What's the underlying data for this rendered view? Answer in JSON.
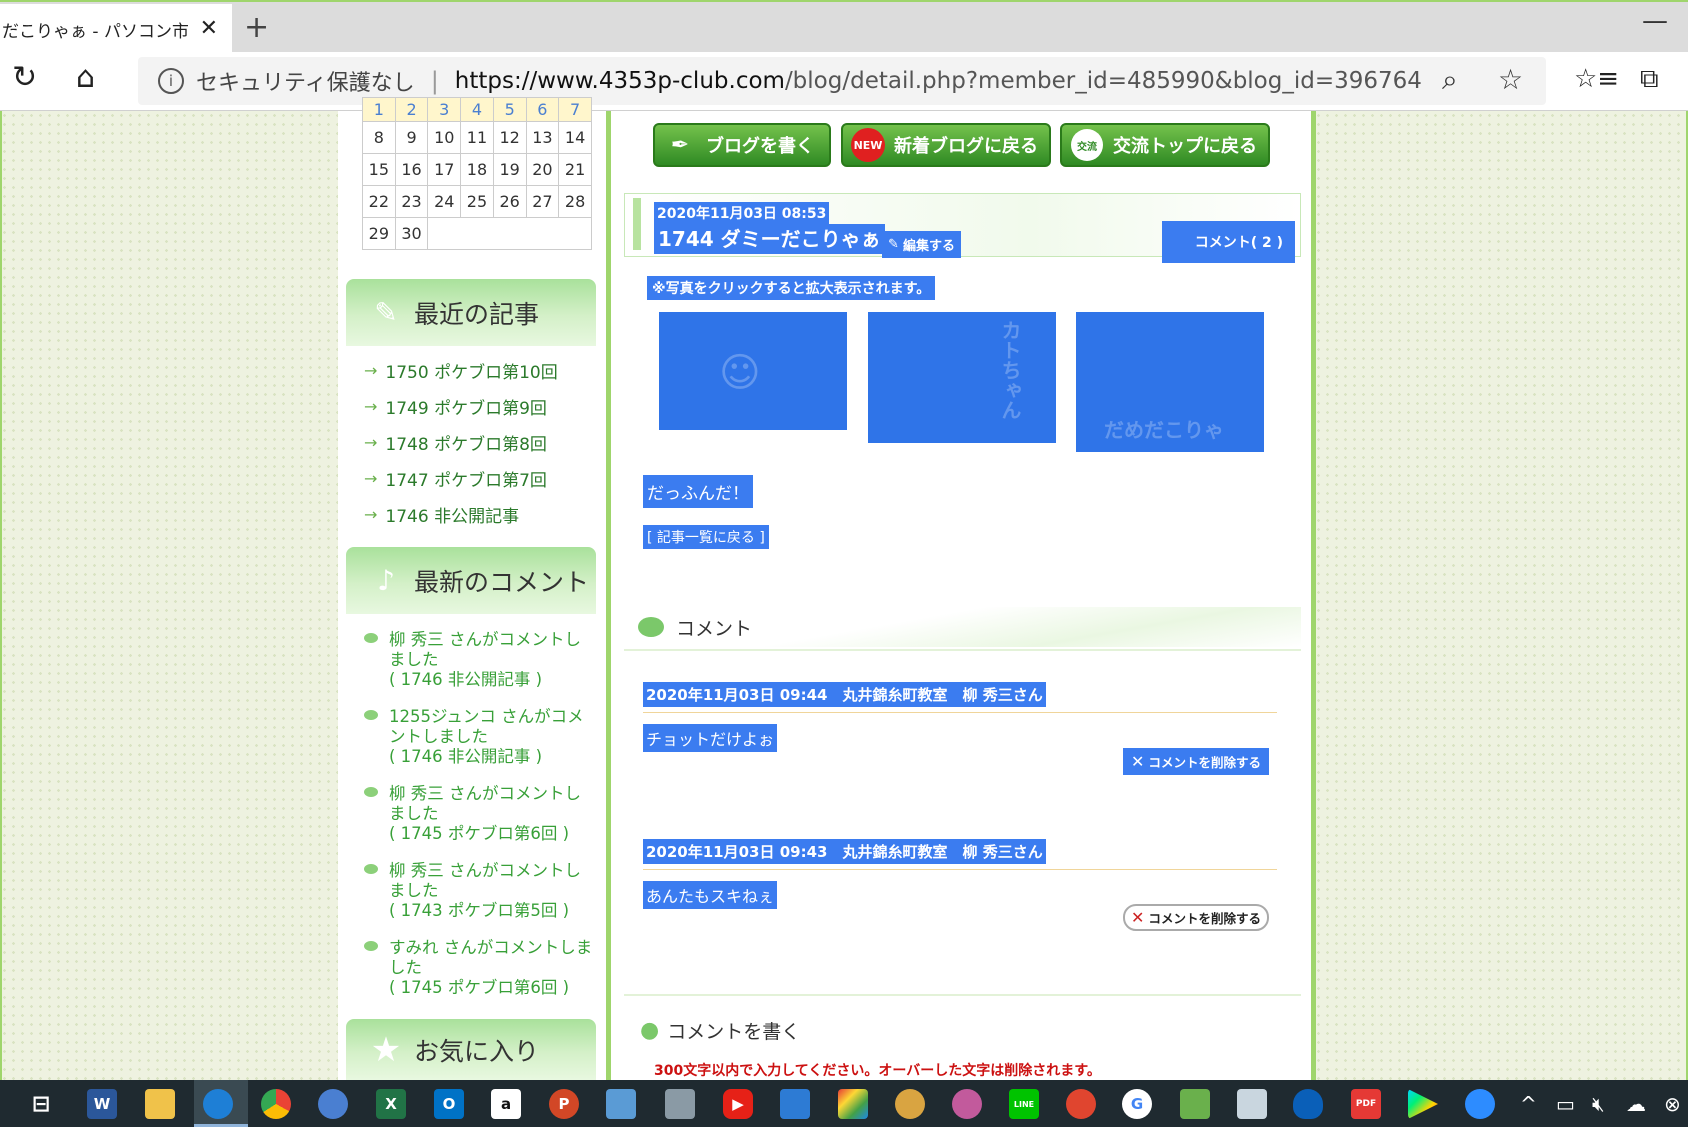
{
  "browser": {
    "tab_title": "だこりゃぁ - パソコン市民講",
    "tab_close": "✕",
    "new_tab": "+",
    "minimize": "—",
    "security_label": "セキュリティ保護なし",
    "url_host": "https://www.4353p-club.com",
    "url_path": "/blog/detail.php?member_id=485990&blog_id=396764"
  },
  "calendar": {
    "rows": [
      [
        "1",
        "2",
        "3",
        "4",
        "5",
        "6",
        "7"
      ],
      [
        "8",
        "9",
        "10",
        "11",
        "12",
        "13",
        "14"
      ],
      [
        "15",
        "16",
        "17",
        "18",
        "19",
        "20",
        "21"
      ],
      [
        "22",
        "23",
        "24",
        "25",
        "26",
        "27",
        "28"
      ],
      [
        "29",
        "30",
        "",
        "",
        "",
        "",
        ""
      ]
    ]
  },
  "sidebar": {
    "recent_title": "最近の記事",
    "recent": [
      "1750 ポケブロ第10回",
      "1749 ポケブロ第9回",
      "1748 ポケブロ第8回",
      "1747 ポケブロ第7回",
      "1746 非公開記事"
    ],
    "comments_title": "最新のコメント",
    "comments": [
      {
        "text": "柳 秀三 さんがコメントしました",
        "ref": "( 1746 非公開記事 )"
      },
      {
        "text": "1255ジュンコ さんがコメントしました",
        "ref": "( 1746 非公開記事 )"
      },
      {
        "text": "柳 秀三 さんがコメントしました",
        "ref": "( 1745 ポケブロ第6回 )"
      },
      {
        "text": "柳 秀三 さんがコメントしました",
        "ref": "( 1743 ポケブロ第5回 )"
      },
      {
        "text": "すみれ さんがコメントしました",
        "ref": "( 1745 ポケブロ第6回 )"
      }
    ],
    "favorites_title": "お気に入り"
  },
  "main": {
    "buttons": {
      "write": "ブログを書く",
      "new_badge": "NEW",
      "new_blogs": "新着ブログに戻る",
      "top_badge": "交流",
      "top": "交流トップに戻る"
    },
    "post": {
      "date": "2020年11月03日 08:53",
      "title": "1744 ダミーだこりゃぁ",
      "edit_label": "編集する",
      "comment_count": "コメント( 2 )",
      "notice": "※写真をクリックすると拡大表示されます。",
      "photo2_text": "カトちゃん",
      "photo3_text": "だめだこりゃ",
      "body": "だっふんだ！",
      "back_link": "[ 記事一覧に戻る ]"
    },
    "comments_section_title": "コメント",
    "comments": [
      {
        "meta": "2020年11月03日 09:44　丸井錦糸町教室　柳 秀三さん",
        "text": "チョットだけよぉ",
        "delete_label": "コメントを削除する"
      },
      {
        "meta": "2020年11月03日 09:43　丸井錦糸町教室　柳 秀三さん",
        "text": "あんたもスキねぇ",
        "delete_label": "コメントを削除する"
      }
    ],
    "write_comment_title": "コメントを書く",
    "write_comment_warning": "300文字以内で入力してください。オーバーした文字は削除されます。"
  },
  "taskbar": {
    "icons": [
      "task-view",
      "word",
      "file-explorer",
      "edge",
      "chrome",
      "people",
      "excel",
      "outlook",
      "amazon",
      "powerpoint",
      "control-panel",
      "printer",
      "youtube",
      "photos",
      "colorful-app",
      "paint",
      "paint-3d",
      "line",
      "game",
      "google",
      "maps",
      "mail-tray",
      "onedrive",
      "pdf-png",
      "play-store",
      "zoom"
    ],
    "word_label": "W",
    "excel_label": "X",
    "outlook_label": "O",
    "amazon_label": "a",
    "ppt_label": "P",
    "line_label": "LINE",
    "google_label": "G",
    "pdf_label": "PDF"
  },
  "colors": {
    "accent_green": "#9fd56c",
    "selection_blue": "#3b7cf0",
    "warning_red": "#cc1111",
    "link_green": "#2b7a2b"
  }
}
